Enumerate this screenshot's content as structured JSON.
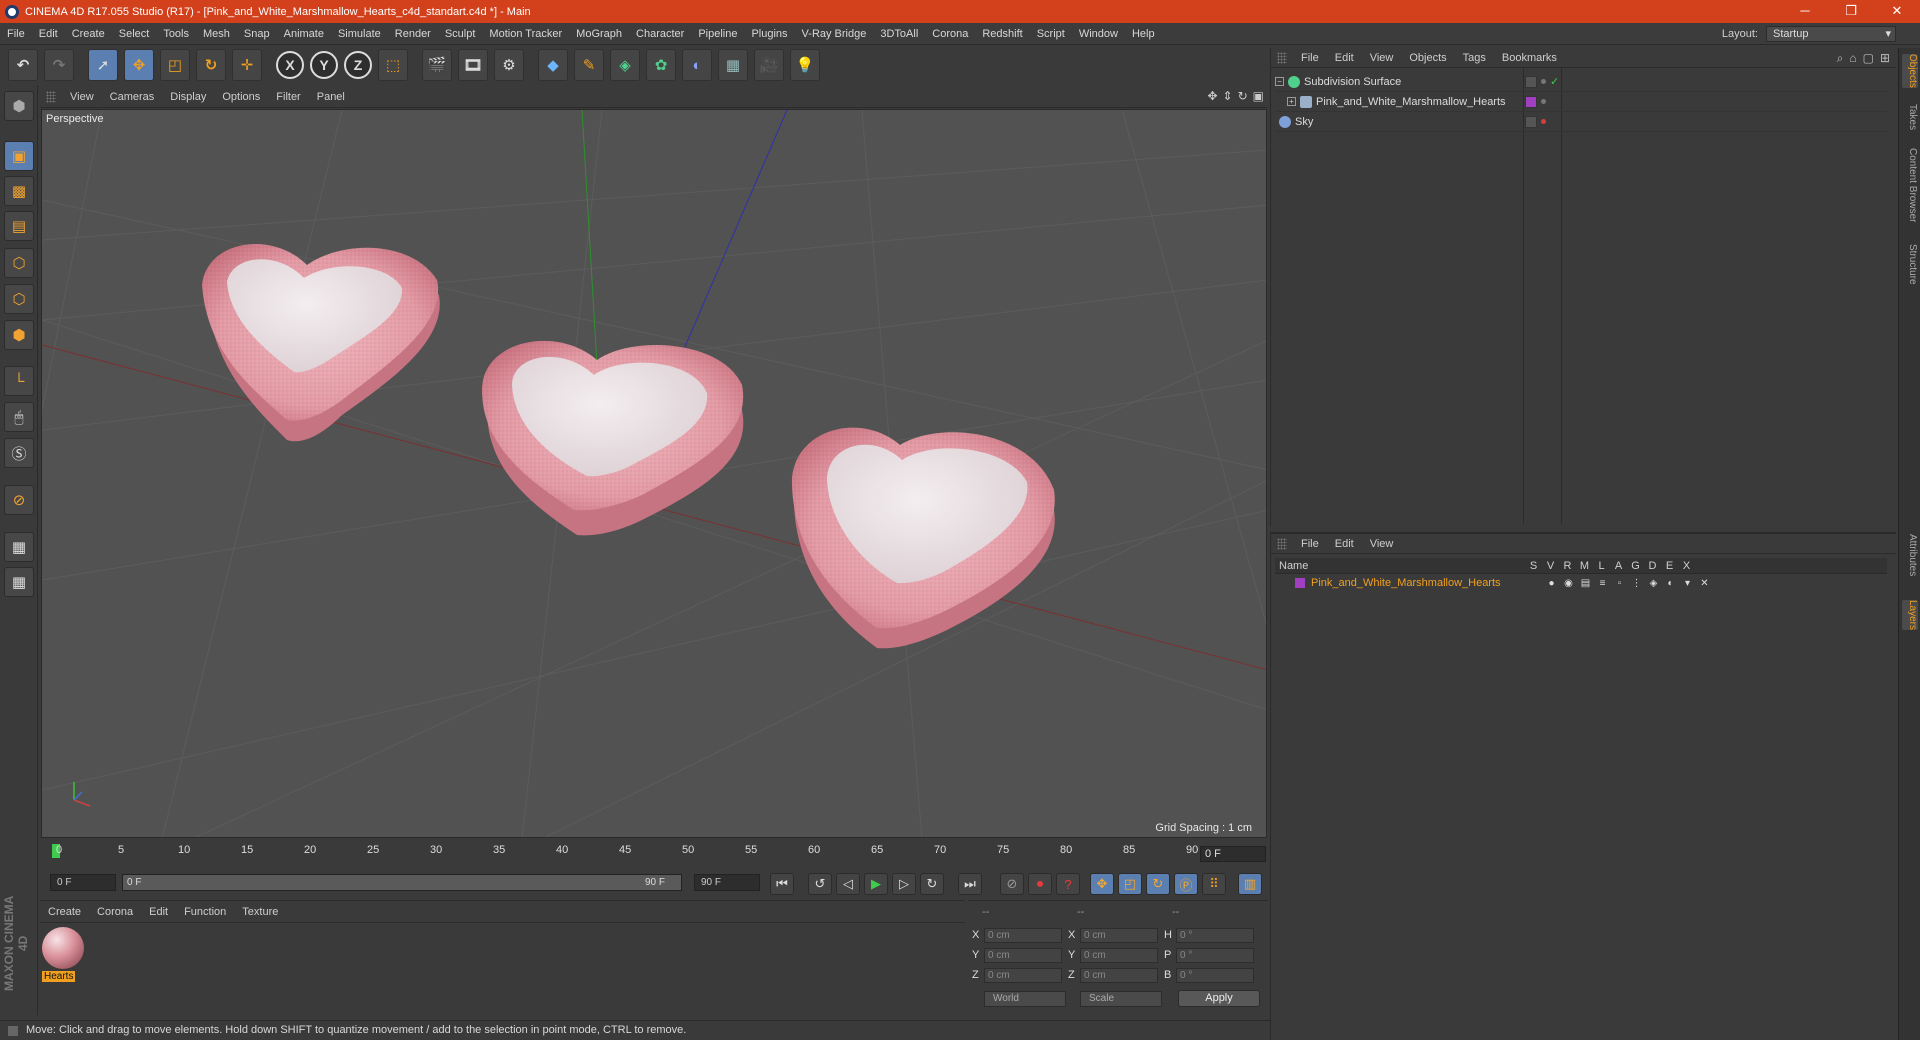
{
  "window": {
    "title": "CINEMA 4D R17.055 Studio (R17) - [Pink_and_White_Marshmallow_Hearts_c4d_standart.c4d *] - Main",
    "controls": [
      "─",
      "❐",
      "✕"
    ]
  },
  "menubar": {
    "items": [
      "File",
      "Edit",
      "Create",
      "Select",
      "Tools",
      "Mesh",
      "Snap",
      "Animate",
      "Simulate",
      "Render",
      "Sculpt",
      "Motion Tracker",
      "MoGraph",
      "Character",
      "Pipeline",
      "Plugins",
      "V-Ray Bridge",
      "3DToAll",
      "Corona",
      "Redshift",
      "Script",
      "Window",
      "Help"
    ],
    "layout_label": "Layout:",
    "layout_value": "Startup"
  },
  "toolbar": {
    "axis_x": "X",
    "axis_y": "Y",
    "axis_z": "Z"
  },
  "viewport": {
    "menu": [
      "View",
      "Cameras",
      "Display",
      "Options",
      "Filter",
      "Panel"
    ],
    "nav_icons": [
      "✥",
      "⇕",
      "↻",
      "▣"
    ],
    "label": "Perspective",
    "grid_spacing": "Grid Spacing : 1 cm"
  },
  "timeline": {
    "ticks": [
      "0",
      "5",
      "10",
      "15",
      "20",
      "25",
      "30",
      "35",
      "40",
      "45",
      "50",
      "55",
      "60",
      "65",
      "70",
      "75",
      "80",
      "85",
      "90"
    ],
    "current_frame": "0 F"
  },
  "transport": {
    "start_field": "0 F",
    "slider_start": "0 F",
    "slider_end": "90 F",
    "end_field": "90 F"
  },
  "materials": {
    "menu": [
      "Create",
      "Corona",
      "Edit",
      "Function",
      "Texture"
    ],
    "items": [
      {
        "name": "Hearts"
      }
    ]
  },
  "coordinates": {
    "headers": [
      "--",
      "--",
      "--"
    ],
    "rows": [
      {
        "a": "X",
        "av": "0 cm",
        "b": "X",
        "bv": "0 cm",
        "c": "H",
        "cv": "0 °"
      },
      {
        "a": "Y",
        "av": "0 cm",
        "b": "Y",
        "bv": "0 cm",
        "c": "P",
        "cv": "0 °"
      },
      {
        "a": "Z",
        "av": "0 cm",
        "b": "Z",
        "bv": "0 cm",
        "c": "B",
        "cv": "0 °"
      }
    ],
    "mode": "World",
    "size_mode": "Scale",
    "apply": "Apply"
  },
  "status": {
    "text": "Move: Click and drag to move elements. Hold down SHIFT to quantize movement / add to the selection in point mode, CTRL to remove."
  },
  "objects": {
    "menu": [
      "File",
      "Edit",
      "View",
      "Objects",
      "Tags",
      "Bookmarks"
    ],
    "items": [
      {
        "name": "Subdivision Surface",
        "color": "#4fd18b"
      },
      {
        "name": "Pink_and_White_Marshmallow_Hearts",
        "color": "#9ab0c8"
      },
      {
        "name": "Sky",
        "color": "#7fa0d8"
      }
    ]
  },
  "layers": {
    "menu": [
      "File",
      "Edit",
      "View"
    ],
    "columns": [
      "Name",
      "S",
      "V",
      "R",
      "M",
      "L",
      "A",
      "G",
      "D",
      "E",
      "X"
    ],
    "items": [
      {
        "name": "Pink_and_White_Marshmallow_Hearts",
        "color": "#a040c0"
      }
    ]
  },
  "right_tabs": [
    "Objects",
    "Takes",
    "Content Browser",
    "Structure",
    "Attributes",
    "Layers"
  ],
  "colors": {
    "title_bar": "#d2411c",
    "accent": "#f0a020",
    "active_tool": "#5a7fb0"
  }
}
